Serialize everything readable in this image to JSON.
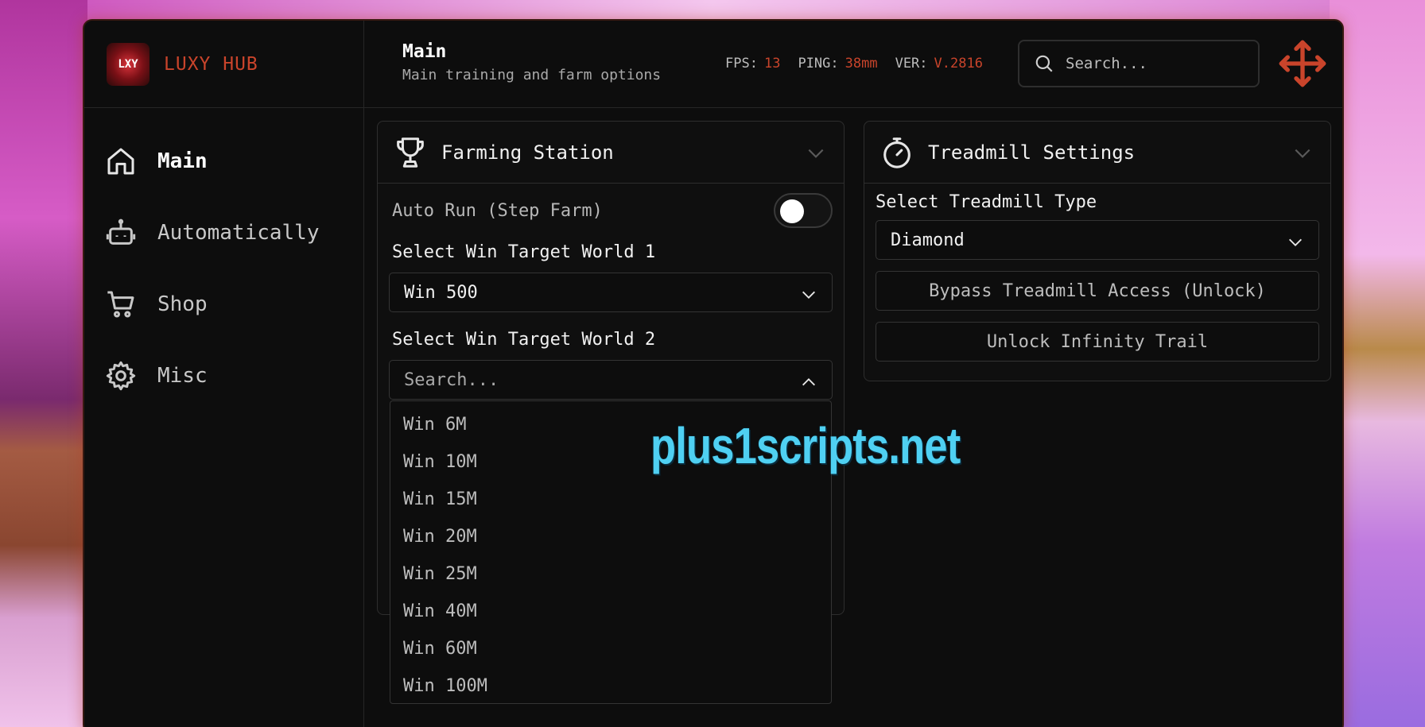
{
  "brand": {
    "name": "LUXY HUB",
    "logo_text": "LXY"
  },
  "page": {
    "title": "Main",
    "subtitle": "Main training and farm options"
  },
  "stats": {
    "fps_label": "FPS:",
    "fps_value": "13",
    "ping_label": "PING:",
    "ping_value": "38mm",
    "ver_label": "VER:",
    "ver_value": "V.2816"
  },
  "search": {
    "placeholder": "Search..."
  },
  "sidebar": {
    "items": [
      {
        "label": "Main",
        "icon": "home-icon",
        "active": true
      },
      {
        "label": "Automatically",
        "icon": "robot-icon",
        "active": false
      },
      {
        "label": "Shop",
        "icon": "cart-icon",
        "active": false
      },
      {
        "label": "Misc",
        "icon": "gear-icon",
        "active": false
      }
    ]
  },
  "farming": {
    "title": "Farming Station",
    "icon": "trophy-icon",
    "auto_run_label": "Auto Run (Step Farm)",
    "auto_run_enabled": false,
    "world1_label": "Select Win Target World 1",
    "world1_value": "Win 500",
    "world2_label": "Select Win Target World 2",
    "world2_placeholder": "Search...",
    "world2_options": [
      "Win 6M",
      "Win 10M",
      "Win 15M",
      "Win 20M",
      "Win 25M",
      "Win 40M",
      "Win 60M",
      "Win 100M"
    ]
  },
  "treadmill": {
    "title": "Treadmill Settings",
    "icon": "stopwatch-icon",
    "type_label": "Select Treadmill Type",
    "type_value": "Diamond",
    "bypass_button": "Bypass Treadmill Access (Unlock)",
    "trail_button": "Unlock Infinity Trail"
  },
  "watermark": "plus1scripts.net",
  "colors": {
    "accent": "#c9442b",
    "background": "#0d0d0d",
    "border": "#2e2e2e",
    "watermark": "#4fd0f2"
  }
}
